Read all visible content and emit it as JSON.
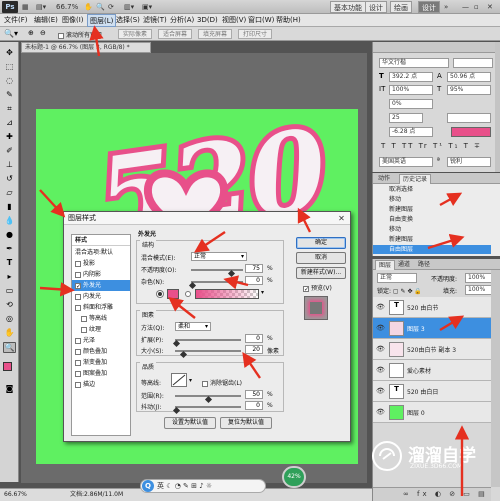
{
  "app": {
    "logo": "Ps",
    "zoom_text": "66.7%",
    "workspace_buttons": [
      "基本功能",
      "设计",
      "绘画"
    ],
    "design_button": "设计"
  },
  "menu": [
    "文件(F)",
    "编辑(E)",
    "图像(I)",
    "图层(L)",
    "选择(S)",
    "滤镜(T)",
    "分析(A)",
    "3D(D)",
    "视图(V)",
    "窗口(W)",
    "帮助(H)"
  ],
  "options_bar": {
    "scroll_all": "滚动所有窗口",
    "actual_pixels": "实际像素",
    "fit_screen": "适合屏幕",
    "fill_screen": "填充屏幕",
    "print_size": "打印尺寸"
  },
  "document": {
    "tab": "未标题-1 @ 66.7% (图层 3, RGB/8) *",
    "canvas_text": "520",
    "status_zoom": "66.67%",
    "status_doc": "文档:2.86M/11.0M"
  },
  "character_panel": {
    "font": "华文行楷",
    "size": "392.2 点",
    "leading": "50.96 点",
    "tracking": "25",
    "vscale": "100%",
    "hscale": "95%",
    "percent": "0%",
    "baseline": "-6.28 点",
    "language": "美国英语",
    "antialias": "锐利"
  },
  "history_panel": {
    "tabs": [
      "动作",
      "历史记录"
    ],
    "items": [
      "取消选择",
      "移动",
      "新建图层",
      "自由变换",
      "移动",
      "新建图层",
      "自由图层"
    ]
  },
  "layers_panel": {
    "tabs": [
      "图层",
      "通道",
      "路径"
    ],
    "blend": "正常",
    "opacity_label": "不透明度:",
    "opacity": "100%",
    "fill_label": "填充:",
    "fill": "100%",
    "layers": [
      "520 由白节",
      "图层 3",
      "520由白节 副本 3",
      "爱心素材",
      "520 由白日",
      "图层 0"
    ]
  },
  "dialog": {
    "title": "图层样式",
    "styles_header": "样式",
    "blend_options": "混合选项:默认",
    "style_items": [
      "投影",
      "内阴影",
      "外发光",
      "内发光",
      "斜面和浮雕",
      "等高线",
      "纹理",
      "光泽",
      "颜色叠加",
      "渐变叠加",
      "图案叠加",
      "描边"
    ],
    "section_title": "外发光",
    "structure": "结构",
    "blend_mode_label": "混合模式(E):",
    "blend_mode": "正常",
    "opacity_label": "不透明度(O):",
    "opacity": "75",
    "noise_label": "杂色(N):",
    "noise": "0",
    "pct": "%",
    "elements": "图素",
    "method_label": "方法(Q):",
    "method": "柔和",
    "spread_label": "扩展(P):",
    "spread": "0",
    "size_label": "大小(S):",
    "size": "20",
    "px": "像素",
    "quality": "品质",
    "contour_label": "等高线:",
    "antialias": "消除锯齿(L)",
    "range_label": "范围(R):",
    "range": "50",
    "jitter_label": "抖动(J):",
    "jitter": "0",
    "make_default": "设置为默认值",
    "reset_default": "复位为默认值",
    "ok": "确定",
    "cancel": "取消",
    "new_style": "新建样式(W)...",
    "preview": "预览(V)",
    "glow_color": "#e8508a"
  },
  "watermark": {
    "line1": "溜溜自学",
    "line2": "ZIXUE.3D66.COM"
  },
  "colors": {
    "canvas": "#5ff061",
    "accent": "#3d8fe0",
    "arrow": "#e53020",
    "pink": "#e8508a"
  }
}
